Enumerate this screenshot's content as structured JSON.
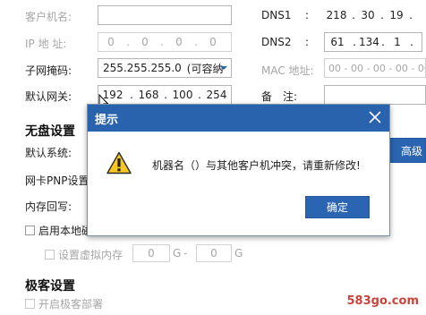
{
  "form": {
    "client_name_label": "客户机名:",
    "ip_label": "IP 地 址:",
    "ip_octets": [
      "0",
      "0",
      "0",
      "0"
    ],
    "subnet_label": "子网掩码:",
    "subnet_value": "255.255.255.0",
    "subnet_dropdown": "(可容纳",
    "gateway_label": "默认网关:",
    "gateway_octets": [
      "192",
      "168",
      "100",
      "254"
    ],
    "dns1_label": "DNS1",
    "dns1_octets": [
      "218",
      "30",
      "19",
      ""
    ],
    "dns2_label": "DNS2",
    "dns2_octets": [
      "61",
      "134",
      "1",
      ""
    ],
    "colon": ":",
    "mac_label": "MAC 地址:",
    "mac_value": "00 - 00 - 00 - 00 - 00 -",
    "note_label": "备　注:"
  },
  "diskless": {
    "section_title": "无盘设置",
    "default_system_label": "默认系统:",
    "nic_pnp_label": "网卡PNP设置:",
    "mem_writeback_label": "内存回写:",
    "enable_local_label": "启用本地磁",
    "virtual_mem_label": "设置虚拟内存",
    "virtual_mem_from": "0",
    "virtual_mem_to": "0",
    "unit_g": "G",
    "dash": "-",
    "advanced_button": "高级"
  },
  "express": {
    "section_title": "极客设置",
    "enable_deploy_label": "开启极客部署"
  },
  "dialog": {
    "title": "提示",
    "message": "机器名（）与其他客户机冲突，请重新修改!",
    "ok_button": "确定"
  },
  "watermark": "583go.com",
  "colors": {
    "dialog_title_bg": "#2a63ad",
    "primary_button": "#2b64b0",
    "watermark": "#c9443a"
  },
  "icons": {
    "warning": "warning-icon",
    "close": "close-icon",
    "dropdown": "chevron-down-icon",
    "cursor": "mouse-cursor-icon"
  }
}
